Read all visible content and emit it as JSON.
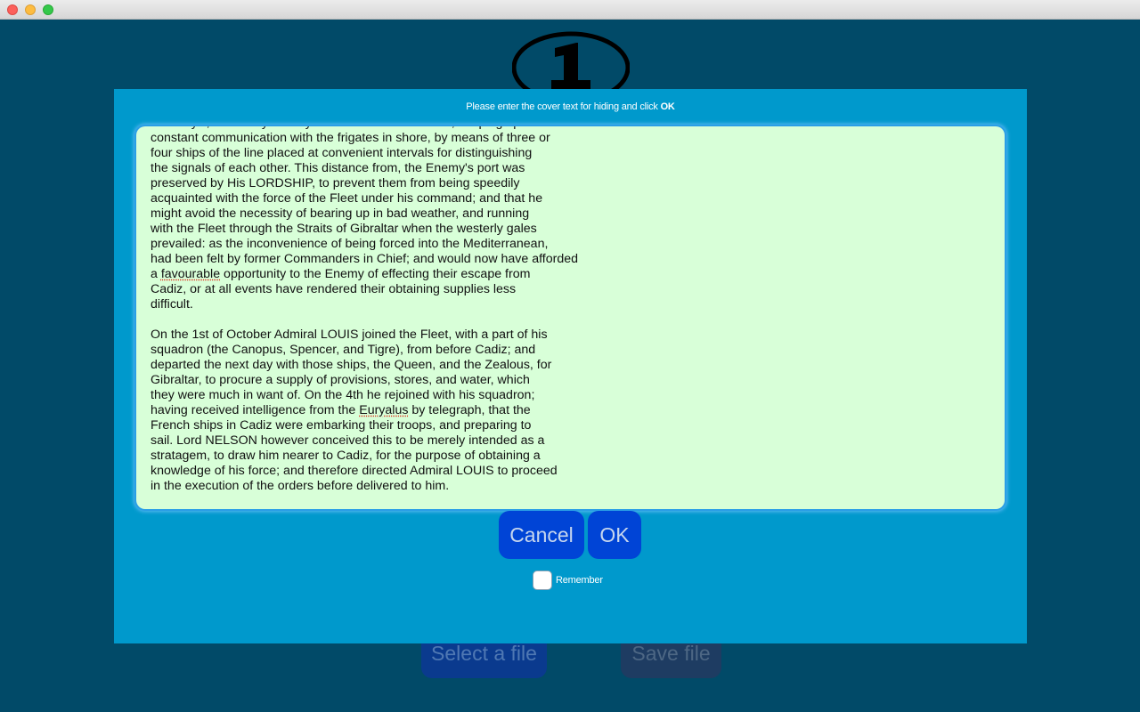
{
  "dialog": {
    "prompt_text": "Please enter the cover text for hiding and click ",
    "prompt_bold": "OK",
    "cover_text": {
      "lines_before_favourable": "St. Mary's, about fifty or sixty miles westward of Cadiz; keeping up a\nconstant communication with the frigates in shore, by means of three or\nfour ships of the line placed at convenient intervals for distinguishing\nthe signals of each other. This distance from, the Enemy's port was\npreserved by His LORDSHIP, to prevent them from being speedily\nacquainted with the force of the Fleet under his command; and that he\nmight avoid the necessity of bearing up in bad weather, and running\nwith the Fleet through the Straits of Gibraltar when the westerly gales\nprevailed: as the inconvenience of being forced into the Mediterranean,\nhad been felt by former Commanders in Chief; and would now have afforded\na ",
      "word_favourable": "favourable",
      "lines_before_euryalus": " opportunity to the Enemy of effecting their escape from\nCadiz, or at all events have rendered their obtaining supplies less\ndifficult.\n\nOn the 1st of October Admiral LOUIS joined the Fleet, with a part of his\nsquadron (the Canopus, Spencer, and Tigre), from before Cadiz; and\ndeparted the next day with those ships, the Queen, and the Zealous, for\nGibraltar, to procure a supply of provisions, stores, and water, which\nthey were much in want of. On the 4th he rejoined with his squadron;\nhaving received intelligence from the ",
      "word_euryalus": "Euryalus",
      "lines_after_euryalus": " by telegraph, that the\nFrench ships in Cadiz were embarking their troops, and preparing to\nsail. Lord NELSON however conceived this to be merely intended as a\nstratagem, to draw him nearer to Cadiz, for the purpose of obtaining a\nknowledge of his force; and therefore directed Admiral LOUIS to proceed\nin the execution of the orders before delivered to him."
    },
    "cancel_label": "Cancel",
    "ok_label": "OK",
    "remember_label": "Remember",
    "remember_checked": false
  },
  "background": {
    "select_file_label": "Select a file",
    "save_file_label": "Save file"
  },
  "colors": {
    "window_bg": "#014a68",
    "dialog_bg": "#0099cc",
    "text_area_bg": "#d8ffd8",
    "button_bg": "#0044d6"
  }
}
